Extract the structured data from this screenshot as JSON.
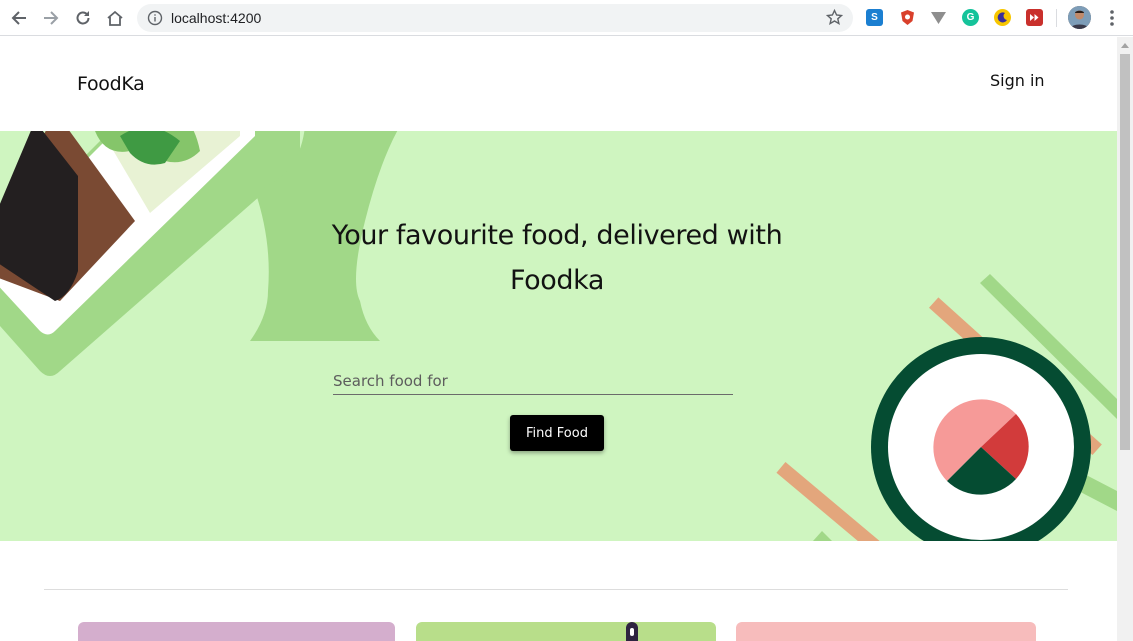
{
  "browser": {
    "url": "localhost:4200",
    "extensions": [
      "skype-extension-icon",
      "brave-shield-icon",
      "vimium-icon",
      "grammarly-icon",
      "crescent-icon",
      "video-speed-icon"
    ]
  },
  "header": {
    "logo": "FoodKa",
    "sign_in": "Sign in"
  },
  "hero": {
    "headline": "Your favourite food, delivered with Foodka",
    "search_placeholder": "Search food for",
    "search_value": "",
    "find_button": "Find Food",
    "background_color": "#cff5c0"
  },
  "cards": {
    "colors": [
      "#d4aecd",
      "#b8de8a",
      "#f7bcbc"
    ]
  }
}
